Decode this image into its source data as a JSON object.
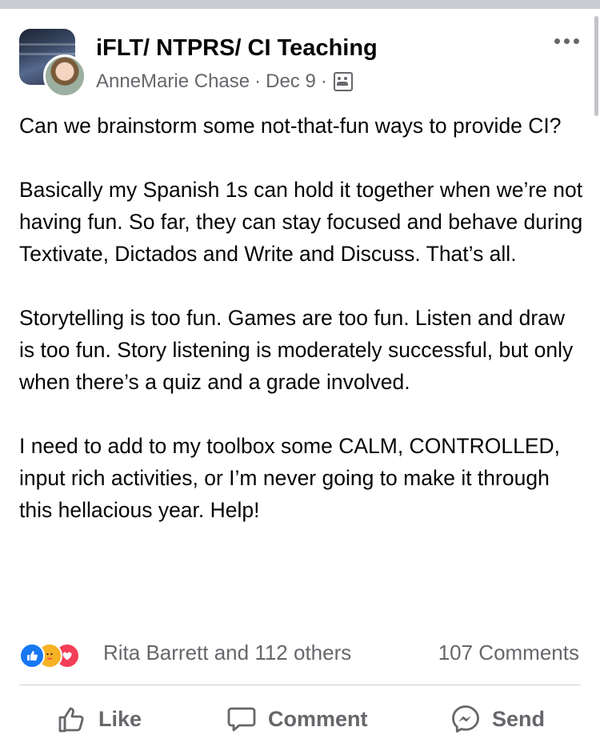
{
  "post": {
    "group_name": "iFLT/ NTPRS/ CI Teaching",
    "author": "AnneMarie Chase",
    "separator": "·",
    "date": "Dec 9",
    "paragraphs": [
      "Can we brainstorm some not-that-fun ways to provide CI?",
      "Basically my Spanish 1s can hold it together when we’re not having fun. So far, they  can stay focused and behave during Textivate,  Dictados and Write and Discuss. That’s all.",
      "Storytelling is too fun. Games are too fun. Listen and draw is too fun. Story listening is moderately successful, but only when there’s a quiz and a grade involved.",
      "I need to add to my toolbox some CALM, CONTROLLED, input rich activities, or I’m never going to make it through this hellacious year. Help!"
    ]
  },
  "reactions": {
    "icons": [
      "like-reaction",
      "care-reaction",
      "love-reaction"
    ],
    "text": "Rita Barrett and 112 others",
    "comments": "107 Comments"
  },
  "actions": {
    "like": "Like",
    "comment": "Comment",
    "send": "Send"
  },
  "colors": {
    "like_blue": "#1877f2",
    "care_yellow": "#f7b125",
    "love_red": "#f33e58",
    "secondary_text": "#65676b"
  }
}
